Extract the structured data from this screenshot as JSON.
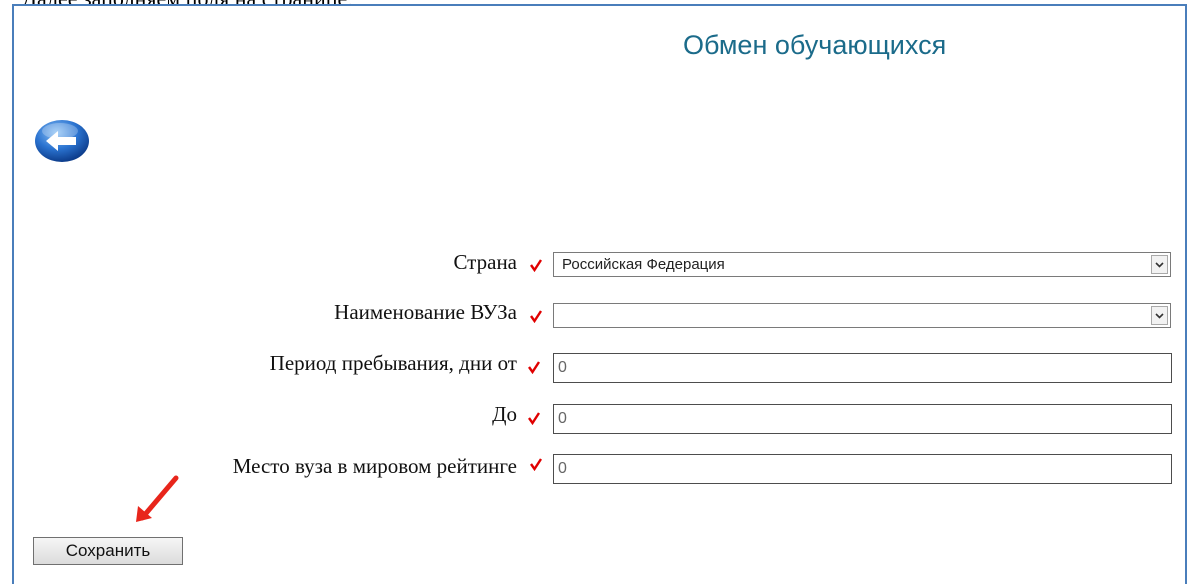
{
  "clipped_text": "Далее заполняем поля на странице;",
  "page": {
    "title": "Обмен обучающихся"
  },
  "icons": {
    "back": "back-arrow-icon",
    "required": "checkmark-icon",
    "annotation": "red-arrow-icon",
    "dropdown": "chevron-down-icon"
  },
  "colors": {
    "title": "#1b6b8a",
    "required_mark": "#e00000",
    "annotation_arrow": "#e8251b",
    "frame": "#4a7ebb"
  },
  "form": {
    "country": {
      "label": "Страна",
      "value": "Российская Федерация"
    },
    "university": {
      "label": "Наименование ВУЗа",
      "value": ""
    },
    "period_from": {
      "label": "Период пребывания, дни от",
      "value": "0"
    },
    "period_to": {
      "label": "До",
      "value": "0"
    },
    "ranking": {
      "label": "Место вуза в мировом рейтинге",
      "value": "0"
    }
  },
  "save_label": "Сохранить"
}
